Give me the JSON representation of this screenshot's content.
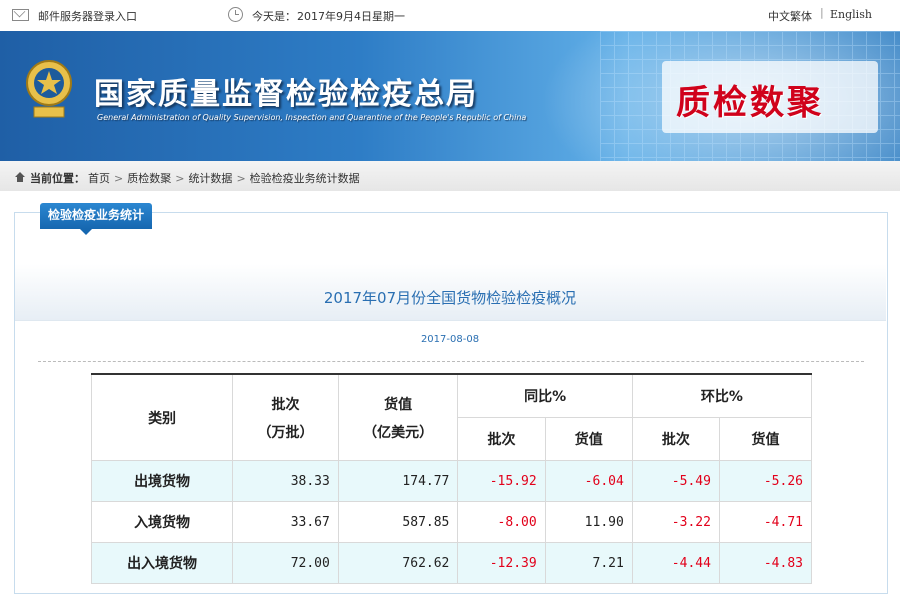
{
  "topbar": {
    "login_link": "邮件服务器登录入口",
    "date_label": "今天是：",
    "date_value": "2017年9月4日星期一",
    "lang_cn": "中文繁体",
    "separator": "|",
    "lang_en": "English"
  },
  "banner": {
    "agency_name": "国家质量监督检验检疫总局",
    "agency_name_en": "General Administration of Quality Supervision, Inspection and Quarantine of the People's Republic of China",
    "brand": "质检数聚"
  },
  "breadcrumb": {
    "label": "当前位置：",
    "items": [
      "首页",
      "质检数聚",
      "统计数据",
      "检验检疫业务统计数据"
    ],
    "arrow": ">"
  },
  "section_tab": "检验检疫业务统计",
  "document": {
    "title": "2017年07月份全国货物检验检疫概况",
    "date": "2017-08-08"
  },
  "table": {
    "headers": {
      "category": "类别",
      "batches": "批次",
      "batches_unit": "（万批）",
      "value": "货值",
      "value_unit": "（亿美元）",
      "yoy": "同比%",
      "mom": "环比%",
      "sub_batches": "批次",
      "sub_value": "货值"
    },
    "rows": [
      {
        "category": "出境货物",
        "batches": "38.33",
        "value": "174.77",
        "yoy_batches": "-15.92",
        "yoy_value": "-6.04",
        "mom_batches": "-5.49",
        "mom_value": "-5.26"
      },
      {
        "category": "入境货物",
        "batches": "33.67",
        "value": "587.85",
        "yoy_batches": "-8.00",
        "yoy_value": "11.90",
        "mom_batches": "-3.22",
        "mom_value": "-4.71"
      },
      {
        "category": "出入境货物",
        "batches": "72.00",
        "value": "762.62",
        "yoy_batches": "-12.39",
        "yoy_value": "7.21",
        "mom_batches": "-4.44",
        "mom_value": "-4.83"
      }
    ]
  },
  "colors": {
    "negative": "#e2001a",
    "banner_blue": "#2e7dc6",
    "brand_red": "#d0021b",
    "link_blue": "#2a6fb2"
  },
  "icons": [
    "mail-icon",
    "clock-icon",
    "location-icon",
    "emblem-icon"
  ]
}
